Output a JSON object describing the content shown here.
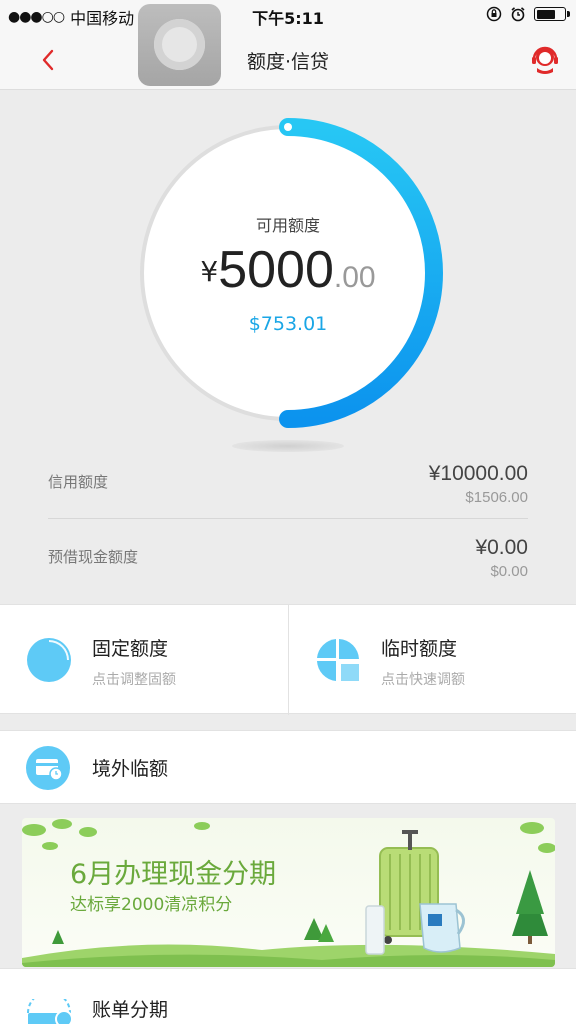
{
  "status_bar": {
    "signal": "●●●○○",
    "carrier": "中国移动",
    "time": "下午5:11"
  },
  "nav": {
    "title": "额度·信贷"
  },
  "gauge": {
    "label": "可用额度",
    "currency": "¥",
    "amount_integer": "5000",
    "amount_decimal": ".00",
    "usd_amount": "$753.01",
    "available_fraction": 0.5
  },
  "limits": [
    {
      "label": "信用额度",
      "cny": "¥10000.00",
      "usd": "$1506.00"
    },
    {
      "label": "预借现金额度",
      "cny": "¥0.00",
      "usd": "$0.00"
    }
  ],
  "quota_cards": [
    {
      "title": "固定额度",
      "subtitle": "点击调整固额",
      "icon": "pie-chart-icon"
    },
    {
      "title": "临时额度",
      "subtitle": "点击快速调额",
      "icon": "split-chart-icon"
    }
  ],
  "overseas": {
    "title": "境外临额",
    "icon": "card-clock-icon"
  },
  "banner": {
    "title": "6月办理现金分期",
    "subtitle": "达标享2000清凉积分"
  },
  "installment": {
    "title": "账单分期",
    "icon": "bill-card-icon"
  },
  "colors": {
    "accent_blue": "#1aa6e6",
    "icon_blue": "#5ecaf6",
    "brand_red": "#e02a2a",
    "banner_green": "#6aa93c"
  }
}
